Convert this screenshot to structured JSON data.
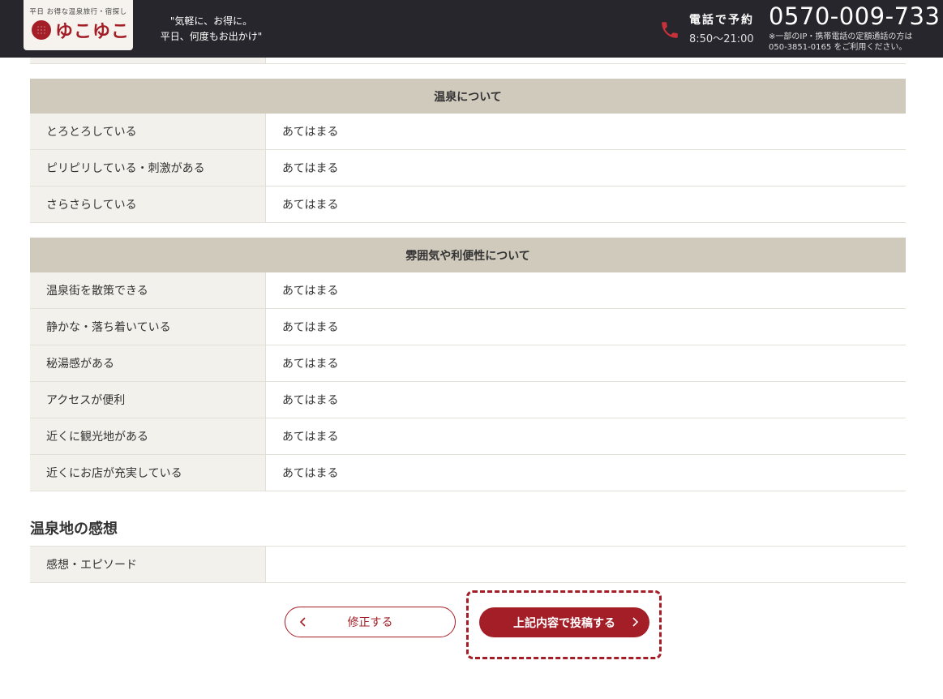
{
  "header": {
    "logo_sub": "平日 お得な温泉旅行・宿探し",
    "logo_text": "ゆこゆこ",
    "slogan_line1": "\"気軽に、お得に。",
    "slogan_line2": "平日、何度もお出かけ\"",
    "phone_label": "電話で予約",
    "phone_hours": "8:50〜21:00",
    "phone_number": "0570-009-733",
    "phone_note_line1": "※一部のIP・携帯電話の定額通話の方は",
    "phone_note_line2": "050-3851-0165 をご利用ください。"
  },
  "onsen_section": {
    "title": "温泉について",
    "rows": [
      {
        "label": "とろとろしている",
        "value": "あてはまる"
      },
      {
        "label": "ピリピリしている・刺激がある",
        "value": "あてはまる"
      },
      {
        "label": "さらさらしている",
        "value": "あてはまる"
      }
    ]
  },
  "atmosphere_section": {
    "title": "雰囲気や利便性について",
    "rows": [
      {
        "label": "温泉街を散策できる",
        "value": "あてはまる"
      },
      {
        "label": "静かな・落ち着いている",
        "value": "あてはまる"
      },
      {
        "label": "秘湯感がある",
        "value": "あてはまる"
      },
      {
        "label": "アクセスが便利",
        "value": "あてはまる"
      },
      {
        "label": "近くに観光地がある",
        "value": "あてはまる"
      },
      {
        "label": "近くにお店が充実している",
        "value": "あてはまる"
      }
    ]
  },
  "impressions": {
    "heading": "温泉地の感想",
    "rows": [
      {
        "label": "感想・エピソード",
        "value": ""
      }
    ]
  },
  "buttons": {
    "fix_label": "修正する",
    "submit_label": "上記内容で投稿する"
  },
  "colors": {
    "header_bg": "#26262c",
    "accent": "#a31e27",
    "section_head_bg": "#d0cabd",
    "label_bg": "#f3f1ec"
  }
}
